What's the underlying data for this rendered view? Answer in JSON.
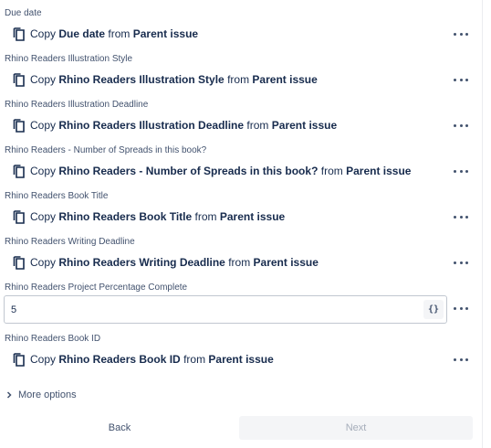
{
  "fields": [
    {
      "label": "Due date",
      "copy_prefix": "Copy",
      "copy_field": "Due date",
      "copy_from": "from",
      "copy_source": "Parent issue"
    },
    {
      "label": "Rhino Readers Illustration Style",
      "copy_prefix": "Copy",
      "copy_field": "Rhino Readers Illustration Style",
      "copy_from": "from",
      "copy_source": "Parent issue"
    },
    {
      "label": "Rhino Readers Illustration Deadline",
      "copy_prefix": "Copy",
      "copy_field": "Rhino Readers Illustration Deadline",
      "copy_from": "from",
      "copy_source": "Parent issue"
    },
    {
      "label": "Rhino Readers - Number of Spreads in this book?",
      "copy_prefix": "Copy",
      "copy_field": "Rhino Readers - Number of Spreads in this book?",
      "copy_from": "from",
      "copy_source": "Parent issue"
    },
    {
      "label": "Rhino Readers Book Title",
      "copy_prefix": "Copy",
      "copy_field": "Rhino Readers Book Title",
      "copy_from": "from",
      "copy_source": "Parent issue"
    },
    {
      "label": "Rhino Readers Writing Deadline",
      "copy_prefix": "Copy",
      "copy_field": "Rhino Readers Writing Deadline",
      "copy_from": "from",
      "copy_source": "Parent issue"
    }
  ],
  "percentage_field": {
    "label": "Rhino Readers Project Percentage Complete",
    "value": "5",
    "smart_value_glyph": "{}"
  },
  "book_id_field": {
    "label": "Rhino Readers Book ID",
    "copy_prefix": "Copy",
    "copy_field": "Rhino Readers Book ID",
    "copy_from": "from",
    "copy_source": "Parent issue"
  },
  "more_options_label": "More options",
  "footer": {
    "back_label": "Back",
    "next_label": "Next"
  },
  "icons": {
    "copy": "copy-icon",
    "more": "more-icon",
    "expand": "chevron-right-icon"
  }
}
